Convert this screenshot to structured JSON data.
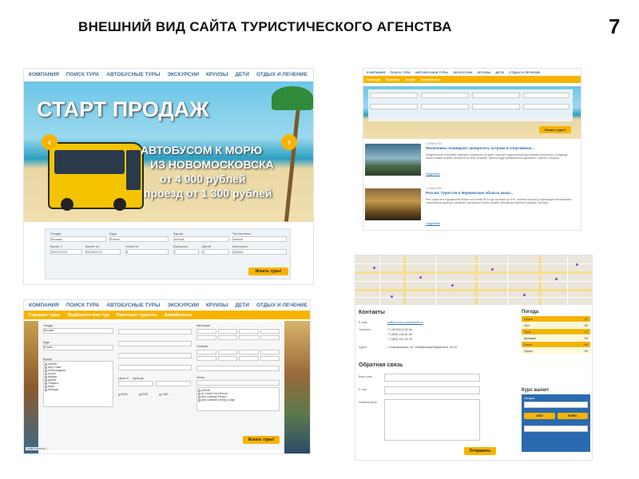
{
  "slide": {
    "title": "ВНЕШНИЙ ВИД САЙТА ТУРИСТИЧЕСКОГО АГЕНСТВА",
    "number": "7"
  },
  "main_nav": [
    "КОМПАНИЯ",
    "ПОИСК ТУРА",
    "АВТОБУСНЫЕ ТУРЫ",
    "ЭКСКУРСИИ",
    "КРУИЗЫ",
    "ДЕТИ",
    "ОТДЫХ И ЛЕЧЕНИЕ"
  ],
  "banner": {
    "headline": "СТАРТ ПРОДАЖ",
    "line1": "АВТОБУСОМ К МОРЮ",
    "line2": "ИЗ НОВОМОСКОВСКА",
    "line3": "от 4 000 рублей",
    "line4": "проезд от 1 300 рублей"
  },
  "search_form": {
    "labels": [
      "Откуда",
      "Куда",
      "Курорт",
      "Тип питания",
      "Вылет с",
      "Вылет по",
      "Ночей от",
      "Взрослых",
      "Детей",
      "Категория"
    ],
    "values": [
      "Москва",
      "Египет",
      "любой",
      "любое",
      "28/05/2015",
      "05/06/2015",
      "6",
      "2",
      "0",
      "любая"
    ],
    "submit": "Искать туры!"
  },
  "shot2": {
    "tabs": [
      "Горящие",
      "Новинки",
      "Акции",
      "Автобусные"
    ],
    "submit": "Искать туры!",
    "news": [
      {
        "date": "13 Мая 2015",
        "title": "Филиппины планируют превратить острова в спортивные...",
        "text": "Правительство Филиппин планирует превратить острова Спратли в туристическую достопримечательность, в надежде снизить накал споров с Китаем из-за этих островов. Туристы будут добираться на архипелаг Спратли с острова...",
        "more": "Подробнее"
      },
      {
        "date": "13 Мая 2015",
        "title": "Россия: Туристов в Мурманскую область выро...",
        "text": "Рост туристов в Мурманской области по итогам 2014 года составил до 30%, особым спросом у отдыхающих пользовались горнолыжные курорты и рыбалка, рассказали в пресс-службе губернатора региона Григорий Стрелков...",
        "more": "Подробнее"
      }
    ]
  },
  "shot3": {
    "nav": [
      "КОМПАНИЯ",
      "ПОИСК ТУРА",
      "АВТОБУСНЫЕ ТУРЫ",
      "ЭКСКУРСИИ",
      "КРУИЗЫ",
      "ДЕТИ",
      "ОТДЫХ И ЛЕЧЕНИЕ"
    ],
    "tabs": [
      "Горящие туры",
      "Подберите мне тур",
      "Пакетные туристы",
      "Авиабилеты"
    ],
    "from_label": "Откуда",
    "from_value": "Москва",
    "to_label": "Куда",
    "to_value": "Египет",
    "resort_label": "Курорт",
    "resorts": [
      "любой",
      "Абу Сома",
      "Александрия",
      "Асуан",
      "Бирма",
      "Дахаб",
      "Сафага",
      "Каир",
      "Макади"
    ],
    "price_label": "Цена от",
    "price_to_label": "Цена до",
    "currencies": [
      "RUB",
      "EUR",
      "USD"
    ],
    "category_label": "Категория",
    "meal_label": "Питание",
    "hotel_label": "Отель",
    "hotels": [
      "любой",
      "Al Grand Sea Resort",
      "Abu Dabbab Resort",
      "Abu Dabbab Diving Lodge"
    ],
    "submit": "Искать туры!",
    "url": "kolibri-tours.ru/..."
  },
  "shot4": {
    "contacts_title": "Контакты",
    "email_label": "E-mail:",
    "email": "kolibria-tours-nmsk@mail.ru",
    "phone_label": "Телефон:",
    "phones": [
      "+7 (48762) 6-92-94",
      "+7 (905) 116-92-94",
      "+7 (962) 101-29-33"
    ],
    "address_label": "Адрес:",
    "address": "г. Новомосковск, ул. Октябрьская/Садовского, 41/23",
    "feedback_title": "Обратная связь",
    "name_label": "Ваше имя",
    "mail_label": "E-mail",
    "comment_label": "Комментарий",
    "send": "Отправить"
  },
  "weather": {
    "title": "Погода",
    "rows": [
      {
        "city": "Греция",
        "temp": "+32"
      },
      {
        "city": "ОАЭ",
        "temp": "+33"
      },
      {
        "city": "Тунис",
        "temp": "+27"
      },
      {
        "city": "Ирландия",
        "temp": "+16"
      },
      {
        "city": "Египет",
        "temp": "+36"
      },
      {
        "city": "Турция",
        "temp": "+30"
      }
    ]
  },
  "currency": {
    "title": "Курс валют",
    "head": "Сегодня",
    "buttons": [
      "USD",
      "EURO"
    ]
  },
  "colors": {
    "accent": "#f6b400",
    "link": "#2a6ab0"
  }
}
